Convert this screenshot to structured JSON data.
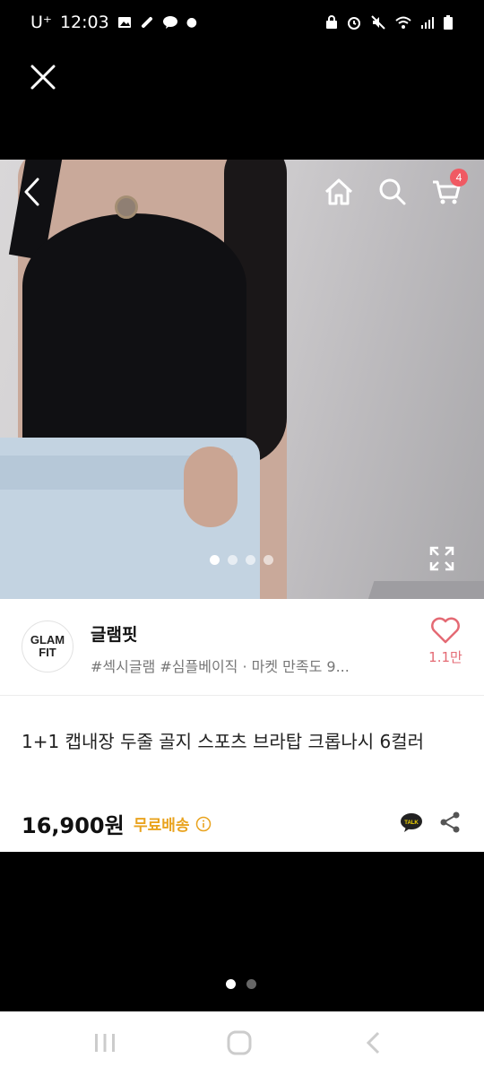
{
  "status_bar": {
    "carrier": "U⁺",
    "time": "12:03",
    "left_icons": [
      "gallery-icon",
      "link-icon",
      "kakaotalk-icon",
      "dot-icon"
    ],
    "right_icons": [
      "lock-icon",
      "alarm-icon",
      "mute-icon",
      "wifi-icon",
      "signal-icon",
      "battery-icon"
    ]
  },
  "viewer": {
    "close_icon": "close-icon"
  },
  "hero": {
    "cart_badge": "4",
    "carousel_total": 4,
    "carousel_active": 1
  },
  "store": {
    "logo_line1": "GLAM",
    "logo_line2": "FIT",
    "name": "글램핏",
    "tags": "#섹시글램 #심플베이직 · 마켓 만족도 9...",
    "likes": "1.1만"
  },
  "product": {
    "title": "1+1 캡내장 두줄 골지 스포츠 브라탑 크롭나시 6컬러",
    "price": "16,900원",
    "shipping": "무료배송"
  },
  "colors": {
    "badge": "#f05a63",
    "heart": "#e46a74",
    "shipping": "#e9a31e"
  },
  "pager": {
    "total": 2,
    "active": 1
  }
}
